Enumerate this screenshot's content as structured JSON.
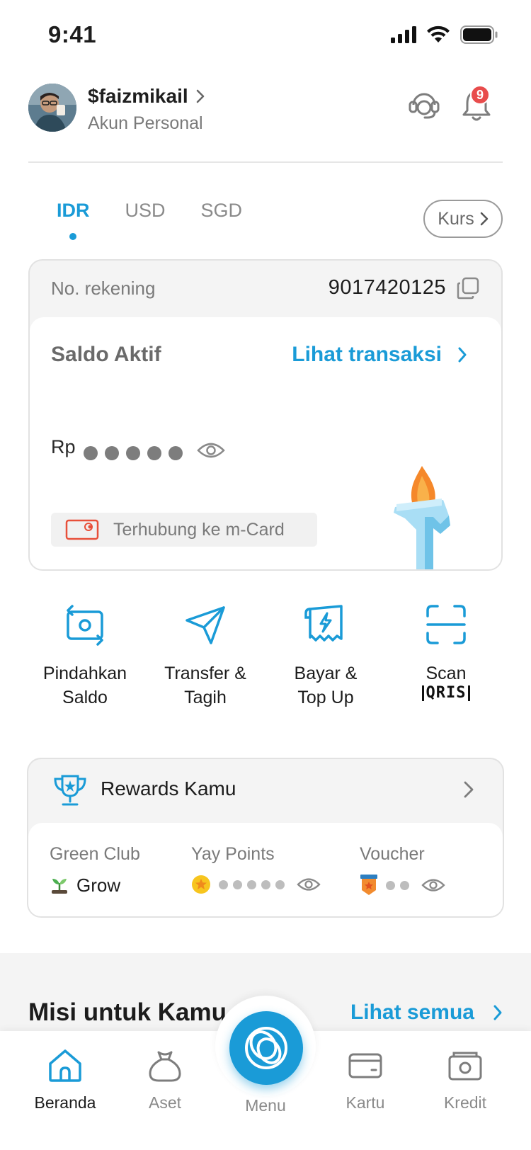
{
  "status_bar": {
    "time": "9:41"
  },
  "header": {
    "username": "$faizmikail",
    "account_type": "Akun Personal",
    "notification_count": "9"
  },
  "currency_tabs": [
    {
      "label": "IDR",
      "active": true
    },
    {
      "label": "USD",
      "active": false
    },
    {
      "label": "SGD",
      "active": false
    }
  ],
  "kurs_label": "Kurs",
  "balance": {
    "account_label": "No. rekening",
    "account_number": "9017420125",
    "saldo_label": "Saldo Aktif",
    "view_transactions": "Lihat transaksi",
    "currency_prefix": "Rp",
    "linked_card": "Terhubung ke m-Card"
  },
  "actions": [
    {
      "label": "Pindahkan\nSaldo",
      "icon": "transfer-balance-icon"
    },
    {
      "label": "Transfer &\nTagih",
      "icon": "send-icon"
    },
    {
      "label": "Bayar &\nTop Up",
      "icon": "bill-icon"
    },
    {
      "label": "Scan",
      "sub": "QRIS",
      "icon": "scan-icon"
    }
  ],
  "rewards": {
    "title": "Rewards Kamu",
    "green_club_label": "Green Club",
    "green_club_value": "Grow",
    "yay_points_label": "Yay Points",
    "voucher_label": "Voucher"
  },
  "mission": {
    "title": "Misi untuk Kamu",
    "see_all": "Lihat semua"
  },
  "bottom_nav": [
    {
      "label": "Beranda",
      "icon": "home-icon",
      "active": true
    },
    {
      "label": "Aset",
      "icon": "money-bag-icon",
      "active": false
    },
    {
      "label": "Menu",
      "icon": "menu-logo-icon",
      "active": false
    },
    {
      "label": "Kartu",
      "icon": "card-icon",
      "active": false
    },
    {
      "label": "Kredit",
      "icon": "credit-icon",
      "active": false
    }
  ],
  "colors": {
    "accent": "#1a9bd7",
    "badge": "#e84c4c",
    "card_bg": "#f4f4f4"
  }
}
